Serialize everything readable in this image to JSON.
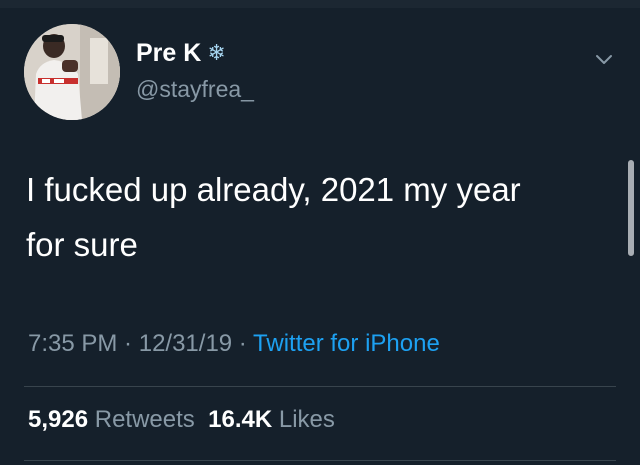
{
  "user": {
    "display_name": "Pre K",
    "badge_icon": "snowflake-icon",
    "handle": "@stayfrea_"
  },
  "tweet": {
    "text_line1": "I fucked up already, 2021 my year",
    "text_line2": "for sure",
    "time": "7:35 PM",
    "date": "12/31/19",
    "source": "Twitter for iPhone"
  },
  "stats": {
    "retweets_count": "5,926",
    "retweets_label": "Retweets",
    "likes_count": "16.4K",
    "likes_label": "Likes"
  },
  "colors": {
    "background": "#15202b",
    "secondary_text": "#8899a6",
    "accent": "#1da1f2"
  }
}
